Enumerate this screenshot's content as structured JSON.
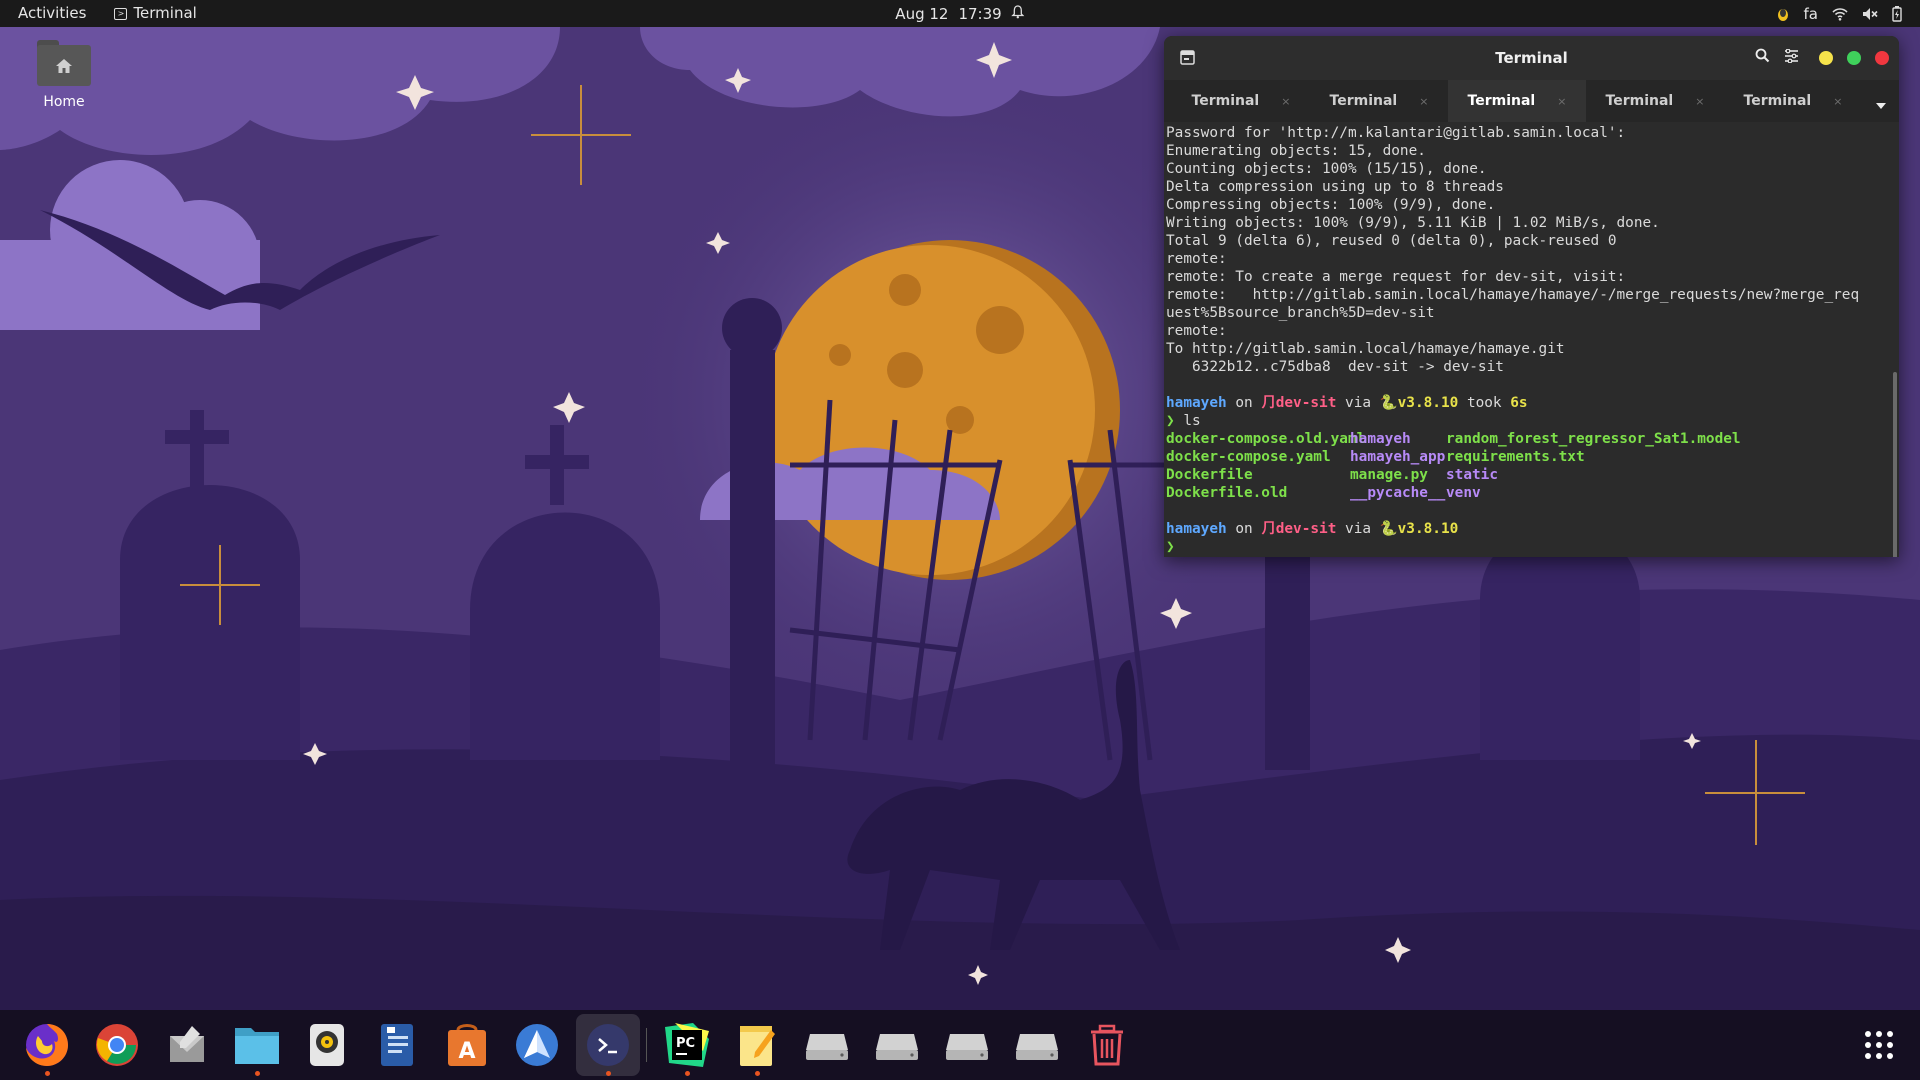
{
  "topbar": {
    "activities": "Activities",
    "app_name": "Terminal",
    "date": "Aug 12",
    "time": "17:39",
    "keyboard_layout": "fa"
  },
  "desktop": {
    "home_label": "Home"
  },
  "terminal": {
    "title": "Terminal",
    "tabs": [
      {
        "label": "Terminal",
        "active": false
      },
      {
        "label": "Terminal",
        "active": false
      },
      {
        "label": "Terminal",
        "active": true
      },
      {
        "label": "Terminal",
        "active": false
      },
      {
        "label": "Terminal",
        "active": false
      }
    ],
    "tab_close": "×",
    "output_lines": [
      "Password for 'http://m.kalantari@gitlab.samin.local':",
      "Enumerating objects: 15, done.",
      "Counting objects: 100% (15/15), done.",
      "Delta compression using up to 8 threads",
      "Compressing objects: 100% (9/9), done.",
      "Writing objects: 100% (9/9), 5.11 KiB | 1.02 MiB/s, done.",
      "Total 9 (delta 6), reused 0 (delta 0), pack-reused 0",
      "remote:",
      "remote: To create a merge request for dev-sit, visit:",
      "remote:   http://gitlab.samin.local/hamaye/hamaye/-/merge_requests/new?merge_req",
      "uest%5Bsource_branch%5D=dev-sit",
      "remote:",
      "To http://gitlab.samin.local/hamaye/hamaye.git",
      "   6322b12..c75dba8  dev-sit -> dev-sit"
    ],
    "prompt1": {
      "user": "hamayeh",
      "on": " on ",
      "branch_symbol": "⺆",
      "branch": "dev-sit",
      "via": " via ",
      "py_symbol": "🐍",
      "py_version": "v3.8.10",
      "took": " took ",
      "duration": "6s"
    },
    "prompt_char": "❯",
    "command": " ls",
    "ls": {
      "col1": [
        "docker-compose.old.yaml",
        "docker-compose.yaml",
        "Dockerfile",
        "Dockerfile.old"
      ],
      "col2": [
        "hamayeh",
        "hamayeh_app",
        "manage.py",
        "__pycache__"
      ],
      "col3": [
        "random_forest_regressor_Sat1.model",
        "requirements.txt",
        "static",
        "venv"
      ]
    },
    "prompt2": {
      "user": "hamayeh",
      "on": " on ",
      "branch_symbol": "⺆",
      "branch": "dev-sit",
      "via": " via ",
      "py_symbol": "🐍",
      "py_version": "v3.8.10"
    }
  },
  "dock": {
    "items": [
      {
        "name": "firefox-icon",
        "running": true
      },
      {
        "name": "chrome-icon",
        "running": false
      },
      {
        "name": "mail-client-icon",
        "running": false
      },
      {
        "name": "files-icon",
        "running": true
      },
      {
        "name": "rhythmbox-icon",
        "running": false
      },
      {
        "name": "text-editor-doc-icon",
        "running": false
      },
      {
        "name": "app-store-icon",
        "running": false
      },
      {
        "name": "vpn-client-icon",
        "running": false
      },
      {
        "name": "terminal-icon",
        "running": true
      },
      {
        "name": "pycharm-icon",
        "running": true
      },
      {
        "name": "notes-icon",
        "running": true
      },
      {
        "name": "drive-icon",
        "running": false
      },
      {
        "name": "drive-icon",
        "running": false
      },
      {
        "name": "drive-icon",
        "running": false
      },
      {
        "name": "drive-icon",
        "running": false
      },
      {
        "name": "trash-icon",
        "running": false
      }
    ],
    "pycharm_label": "PC"
  }
}
